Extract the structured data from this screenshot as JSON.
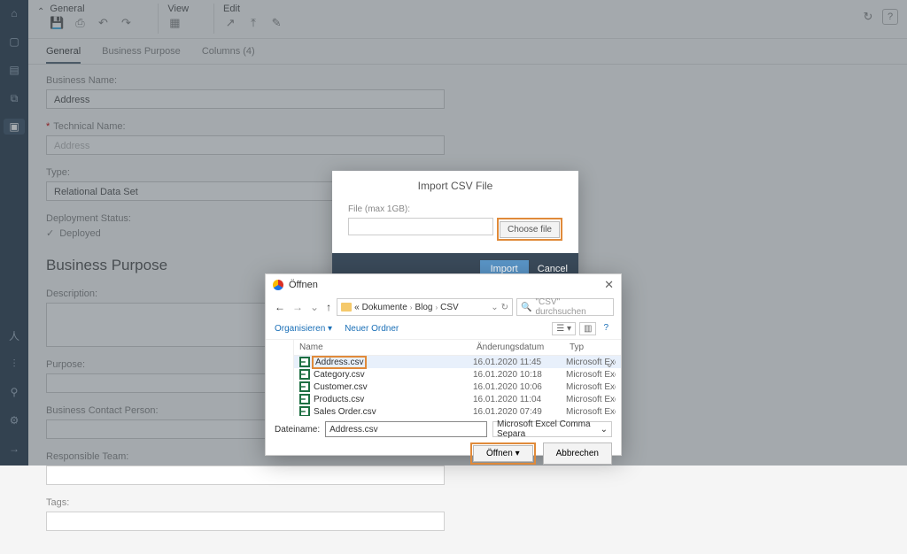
{
  "leftnav": {
    "items": [
      "⌂",
      "▢",
      "▤",
      "⧉",
      "▣",
      "",
      "",
      "",
      "人",
      "⫶",
      "⚲",
      "⚙",
      "→"
    ]
  },
  "topbar": {
    "general_label": "General",
    "view_label": "View",
    "edit_label": "Edit"
  },
  "tabs": {
    "general": "General",
    "bp": "Business Purpose",
    "cols": "Columns (4)"
  },
  "form": {
    "bn_label": "Business Name:",
    "bn_value": "Address",
    "tn_label": "Technical Name:",
    "tn_value": "Address",
    "type_label": "Type:",
    "type_value": "Relational Data Set",
    "dep_label": "Deployment Status:",
    "dep_value": "Deployed"
  },
  "bp_section": "Business Purpose",
  "bp": {
    "desc": "Description:",
    "purpose": "Purpose:",
    "contact": "Business Contact Person:",
    "team": "Responsible Team:",
    "tags": "Tags:"
  },
  "modal": {
    "title": "Import CSV File",
    "file_label": "File (max 1GB):",
    "choose": "Choose file",
    "import": "Import",
    "cancel": "Cancel"
  },
  "dlg": {
    "title": "Öffnen",
    "path": {
      "p1": "Dokumente",
      "p2": "Blog",
      "p3": "CSV"
    },
    "search_ph": "\"CSV\" durchsuchen",
    "organise": "Organisieren",
    "newfolder": "Neuer Ordner",
    "col_name": "Name",
    "col_mod": "Änderungsdatum",
    "col_type": "Typ",
    "files": [
      {
        "name": "Address.csv",
        "mod": "16.01.2020 11:45",
        "type": "Microsoft Exc"
      },
      {
        "name": "Category.csv",
        "mod": "16.01.2020 10:18",
        "type": "Microsoft Exc"
      },
      {
        "name": "Customer.csv",
        "mod": "16.01.2020 10:06",
        "type": "Microsoft Exc"
      },
      {
        "name": "Products.csv",
        "mod": "16.01.2020 11:04",
        "type": "Microsoft Exc"
      },
      {
        "name": "Sales Order.csv",
        "mod": "16.01.2020 07:49",
        "type": "Microsoft Exc"
      }
    ],
    "fn_label": "Dateiname:",
    "fn_value": "Address.csv",
    "filter": "Microsoft Excel Comma Separa",
    "open": "Öffnen",
    "cancel": "Abbrechen"
  }
}
